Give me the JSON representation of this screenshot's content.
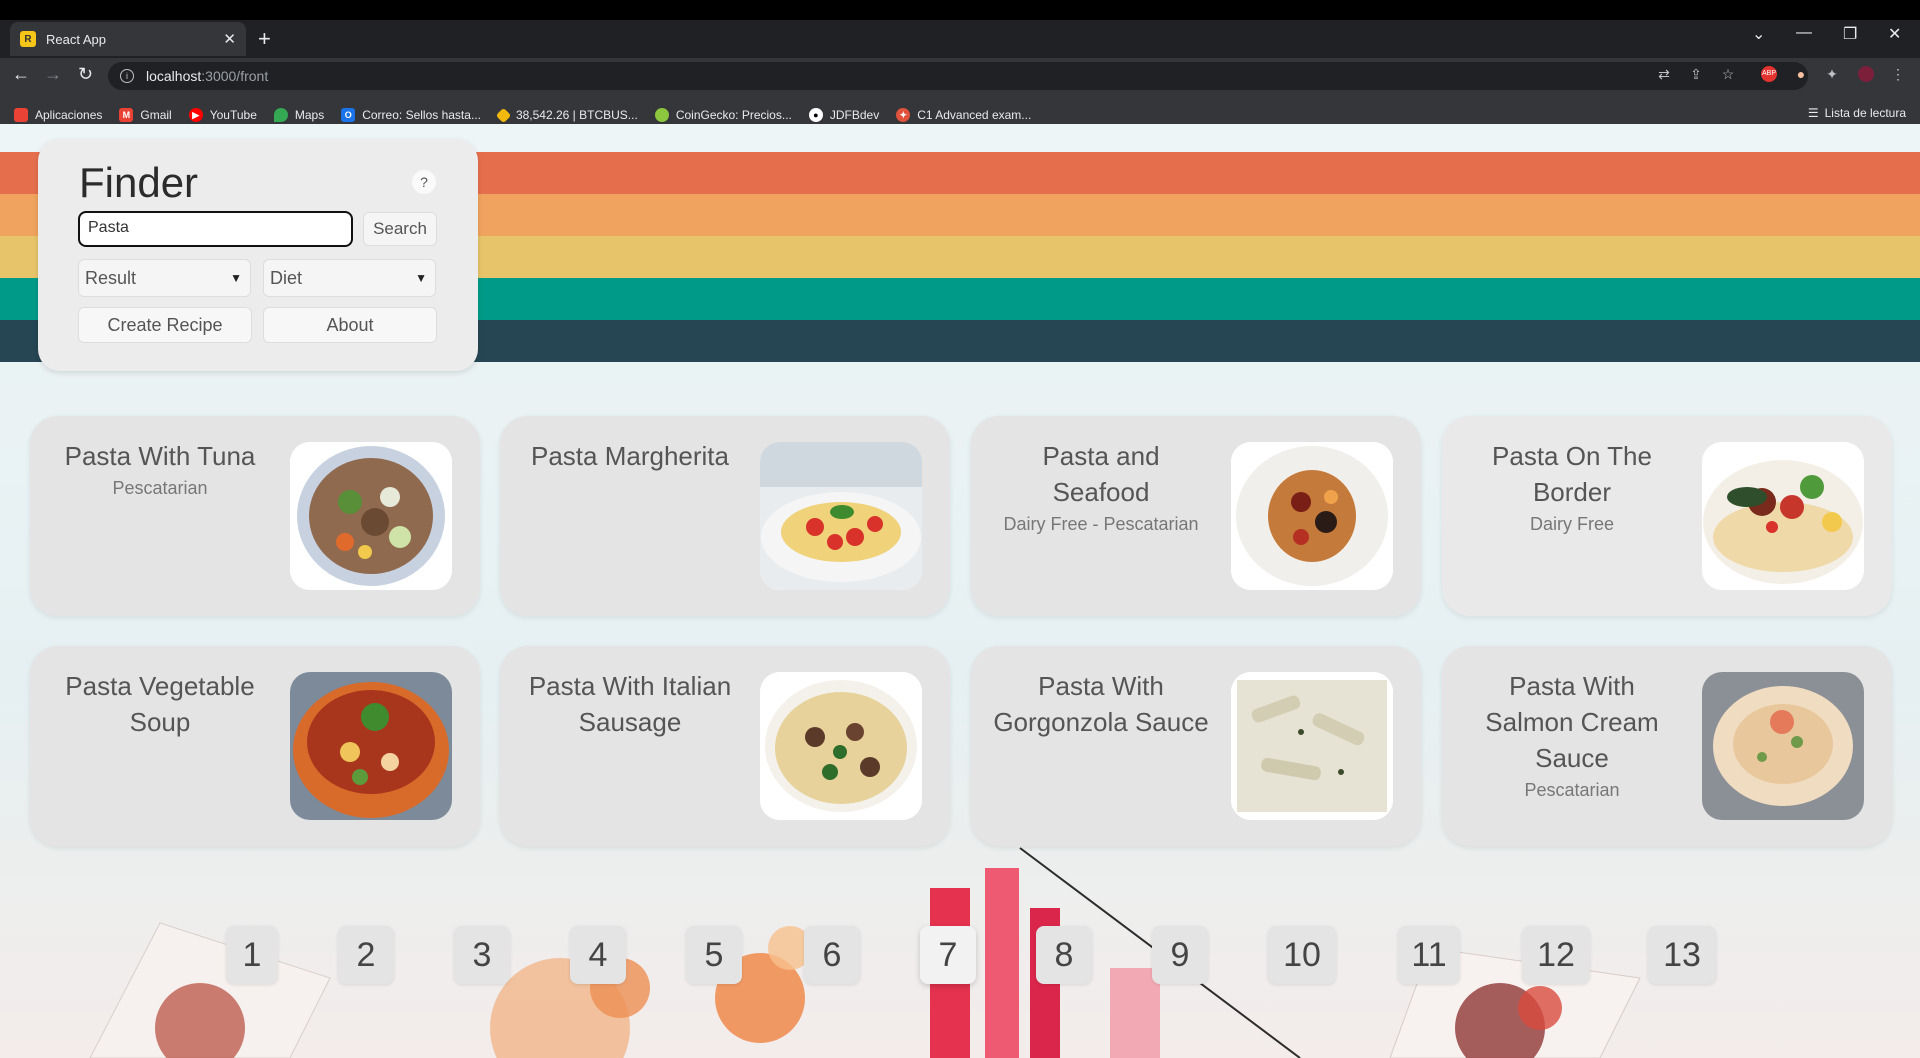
{
  "browser": {
    "tab_title": "React App",
    "url_host": "localhost",
    "url_rest": ":3000/front",
    "bookmarks": [
      {
        "label": "Aplicaciones",
        "color": "#ea4335"
      },
      {
        "label": "Gmail",
        "color": "#ea4335"
      },
      {
        "label": "YouTube",
        "color": "#ff0000"
      },
      {
        "label": "Maps",
        "color": "#34a853"
      },
      {
        "label": "Correo: Sellos hasta...",
        "color": "#1a73e8"
      },
      {
        "label": "38,542.26 | BTCBUS...",
        "color": "#f0b90b"
      },
      {
        "label": "CoinGecko: Precios...",
        "color": "#8dc63f"
      },
      {
        "label": "JDFBdev",
        "color": "#ffffff"
      },
      {
        "label": "C1 Advanced exam...",
        "color": "#e0523c"
      }
    ],
    "reading_list": "Lista de lectura"
  },
  "finder": {
    "title": "Finder",
    "help": "?",
    "search_value": "Pasta",
    "search_button": "Search",
    "result_select": "Result",
    "diet_select": "Diet",
    "create_button": "Create Recipe",
    "about_button": "About"
  },
  "stripe_colors": [
    "#e56f4d",
    "#f0a35e",
    "#e7c46a",
    "#009b88",
    "#264653"
  ],
  "recipes": [
    {
      "title": "Pasta With Tuna",
      "diet": "Pescatarian",
      "img": "tuna"
    },
    {
      "title": "Pasta Margherita",
      "diet": "",
      "img": "margherita"
    },
    {
      "title": "Pasta and Seafood",
      "diet": "Dairy Free - Pescatarian",
      "img": "seafood"
    },
    {
      "title": "Pasta On The Border",
      "diet": "Dairy Free",
      "img": "border"
    },
    {
      "title": "Pasta Vegetable Soup",
      "diet": "",
      "img": "soup"
    },
    {
      "title": "Pasta With Italian Sausage",
      "diet": "",
      "img": "sausage"
    },
    {
      "title": "Pasta With Gorgonzola Sauce",
      "diet": "",
      "img": "gorgonzola"
    },
    {
      "title": "Pasta With Salmon Cream Sauce",
      "diet": "Pescatarian",
      "img": "salmon"
    }
  ],
  "pagination": {
    "pages": [
      "1",
      "2",
      "3",
      "4",
      "5",
      "6",
      "7",
      "8",
      "9",
      "10",
      "11",
      "12",
      "13"
    ],
    "current": "7"
  }
}
